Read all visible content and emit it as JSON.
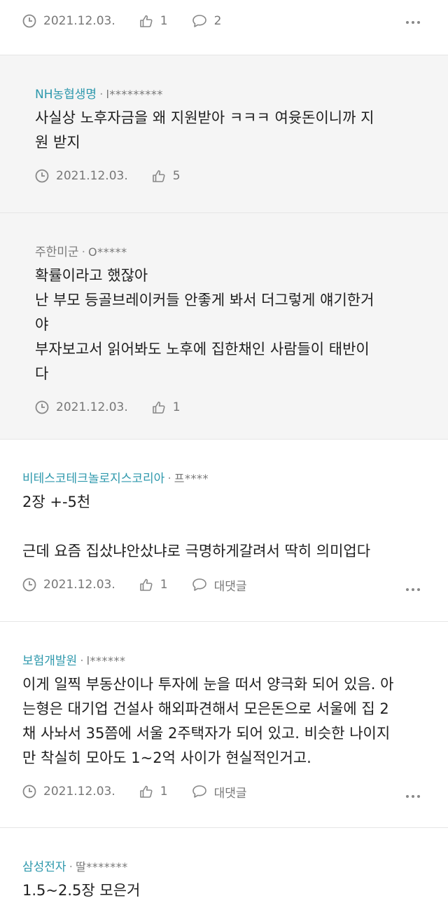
{
  "colors": {
    "author_link": "#2f99ad",
    "muted": "#777777",
    "reply_bg": "#f5f5f5"
  },
  "comments": [
    {
      "author": "",
      "masked_id": "",
      "body": [],
      "date": "2021.12.03.",
      "likes": "1",
      "reply_label": "2"
    },
    {
      "author": "NH농협생명",
      "masked_id": "l*********",
      "body": [
        "사실상 노후자금을 왜 지원받아 ㅋㅋㅋ 여윳돈이니까 지",
        "원 받지"
      ],
      "date": "2021.12.03.",
      "likes": "5"
    },
    {
      "author": "주한미군",
      "masked_id": "O*****",
      "body": [
        "확률이라고 했잖아",
        "난 부모 등골브레이커들 안좋게 봐서 더그렇게 얘기한거",
        "야",
        "부자보고서 읽어봐도 노후에 집한채인 사람들이 태반이",
        "다"
      ],
      "date": "2021.12.03.",
      "likes": "1"
    },
    {
      "author": "비테스코테크놀로지스코리아",
      "masked_id": "프****",
      "body_top": "2장 +-5천",
      "body_bottom": "근데 요즘 집샀냐안샀냐로 극명하게갈려서 딱히 의미업다",
      "date": "2021.12.03.",
      "likes": "1",
      "reply_label": "대댓글"
    },
    {
      "author": "보험개발원",
      "masked_id": "l******",
      "body": [
        "이게 일찍 부동산이나 투자에 눈을 떠서 양극화 되어 있음. 아",
        "는형은 대기업 건설사 해외파견해서 모은돈으로 서울에 집 2",
        "채 사놔서 35쯤에 서울 2주택자가 되어 있고. 비슷한 나이지",
        "만 착실히 모아도 1~2억 사이가 현실적인거고."
      ],
      "date": "2021.12.03.",
      "likes": "1",
      "reply_label": "대댓글"
    },
    {
      "author": "삼성전자",
      "masked_id": "딸*******",
      "body": [
        "1.5~2.5장 모은거"
      ]
    }
  ]
}
